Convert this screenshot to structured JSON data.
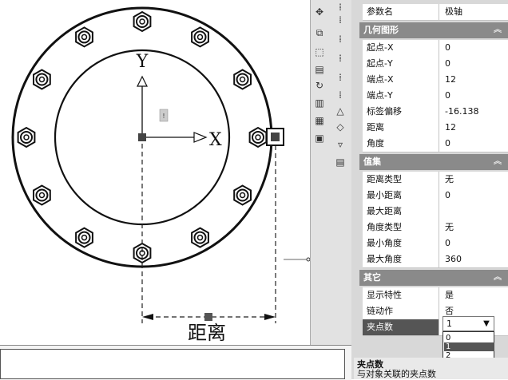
{
  "drawing": {
    "y_label": "Y",
    "x_label": "X",
    "dim_label": "距离"
  },
  "properties": {
    "top_row": {
      "key": "参数名",
      "value": "极轴"
    },
    "geometry": {
      "title": "几何图形",
      "rows": [
        {
          "key": "起点-X",
          "value": "0"
        },
        {
          "key": "起点-Y",
          "value": "0"
        },
        {
          "key": "端点-X",
          "value": "12"
        },
        {
          "key": "端点-Y",
          "value": "0"
        },
        {
          "key": "标签偏移",
          "value": "-16.138"
        },
        {
          "key": "距离",
          "value": "12"
        },
        {
          "key": "角度",
          "value": "0"
        }
      ]
    },
    "value_set": {
      "title": "值集",
      "rows": [
        {
          "key": "距离类型",
          "value": "无"
        },
        {
          "key": "最小距离",
          "value": "0"
        },
        {
          "key": "最大距离",
          "value": ""
        },
        {
          "key": "角度类型",
          "value": "无"
        },
        {
          "key": "最小角度",
          "value": "0"
        },
        {
          "key": "最大角度",
          "value": "360"
        }
      ]
    },
    "other": {
      "title": "其它",
      "rows": [
        {
          "key": "显示特性",
          "value": "是"
        },
        {
          "key": "链动作",
          "value": "否"
        },
        {
          "key": "夹点数",
          "value": "1"
        }
      ]
    },
    "dropdown": {
      "value": "1",
      "options": [
        "0",
        "1",
        "2"
      ]
    },
    "help": {
      "title": "夹点数",
      "description": "与对象关联的夹点数"
    }
  },
  "colors": {
    "section_header": "#8a8a8a",
    "selected": "#555555"
  }
}
